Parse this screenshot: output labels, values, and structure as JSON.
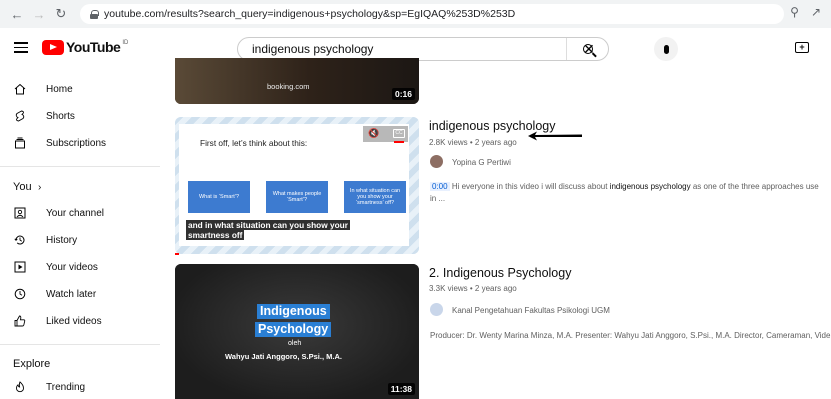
{
  "browser": {
    "url": "youtube.com/results?search_query=indigenous+psychology&sp=EgIQAQ%253D%253D"
  },
  "masthead": {
    "logo_text": "YouTube",
    "logo_sup": "ID",
    "search_value": "indigenous psychology"
  },
  "sidebar": {
    "items": [
      {
        "label": "Home",
        "icon": "home-icon"
      },
      {
        "label": "Shorts",
        "icon": "shorts-icon"
      },
      {
        "label": "Subscriptions",
        "icon": "subscriptions-icon"
      }
    ],
    "you_heading": "You",
    "you_items": [
      {
        "label": "Your channel",
        "icon": "your-channel-icon"
      },
      {
        "label": "History",
        "icon": "history-icon"
      },
      {
        "label": "Your videos",
        "icon": "your-videos-icon"
      },
      {
        "label": "Watch later",
        "icon": "watch-later-icon"
      },
      {
        "label": "Liked videos",
        "icon": "liked-videos-icon"
      }
    ],
    "explore_heading": "Explore",
    "explore_items": [
      {
        "label": "Trending",
        "icon": "trending-icon"
      }
    ]
  },
  "results": [
    {
      "thumb_brand": "booking.com",
      "duration": "0:16"
    },
    {
      "title": "indigenous psychology",
      "meta": "2.8K views • 2 years ago",
      "channel": "Yopina G Pertiwi",
      "snippet_ts": "0:00",
      "snippet_pre": "Hi everyone in this video i will discuss about ",
      "snippet_bold": "indigenous psychology",
      "snippet_post": " as one of the three approaches use",
      "snippet_line2": "in ...",
      "thumb_heading": "First off, let’s think about this:",
      "thumb_box1": "What is ‘Smart’?",
      "thumb_box2": "What makes people ‘Smart’?",
      "thumb_box3": "In what situation can you show your ‘smartness’ off?",
      "thumb_caption1": "and in what situation can you show your",
      "thumb_caption2": "smartness off"
    },
    {
      "title": "2. Indigenous Psychology",
      "meta": "3.3K views • 2 years ago",
      "channel": "Kanal Pengetahuan Fakultas Psikologi UGM",
      "snippet": "Producer: Dr. Wenty Marina Minza, M.A. Presenter: Wahyu Jati Anggoro, S.Psi., M.A. Director, Cameraman, Vide",
      "thumb_line1": "Indigenous",
      "thumb_line2": "Psychology",
      "thumb_line3": "oleh",
      "thumb_line4": "Wahyu Jati Anggoro, S.Psi., M.A.",
      "duration": "11:38"
    }
  ],
  "colors": {
    "brand_red": "#ff0000",
    "thumb_blue": "#3d7bd0",
    "caption_bg": "#303030"
  }
}
